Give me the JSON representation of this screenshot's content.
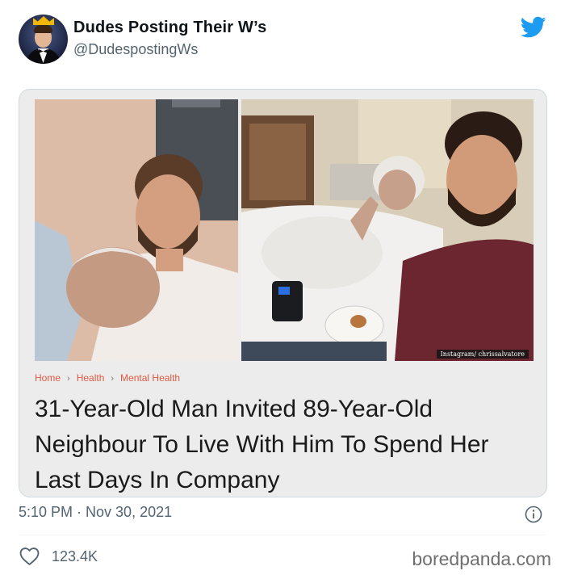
{
  "tweet": {
    "display_name": "Dudes Posting Their W’s",
    "handle": "@DudespostingWs",
    "timestamp": "5:10 PM · Nov 30, 2021",
    "likes": "123.4K"
  },
  "card": {
    "breadcrumb": [
      "Home",
      "Health",
      "Mental Health"
    ],
    "headline": "31-Year-Old Man Invited 89-Year-Old Neighbour To Live With Him To Spend Her Last Days In Company",
    "photo_credit": "Instagram/ chrissalvatore"
  },
  "watermark": "boredpanda.com",
  "icons": {
    "brand": "twitter-bird-icon",
    "info": "info-icon",
    "like": "heart-icon",
    "breadcrumb_separator": "chevron-right-icon"
  },
  "colors": {
    "twitter_blue": "#1d9bf0",
    "breadcrumb_link": "#e05a43",
    "secondary_text": "#536471"
  }
}
